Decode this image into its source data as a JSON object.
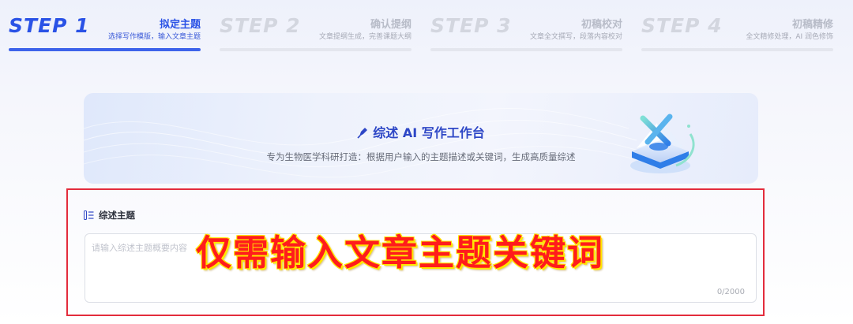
{
  "steps": [
    {
      "num": "STEP 1",
      "name": "拟定主题",
      "desc": "选择写作模版，输入文章主题",
      "active": true
    },
    {
      "num": "STEP 2",
      "name": "确认提纲",
      "desc": "文章提纲生成，完善课题大纲",
      "active": false
    },
    {
      "num": "STEP 3",
      "name": "初稿校对",
      "desc": "文章全文撰写，段落内容校对",
      "active": false
    },
    {
      "num": "STEP 4",
      "name": "初稿精修",
      "desc": "全文精修处理，AI 润色修饰",
      "active": false
    }
  ],
  "banner": {
    "title": "综述 AI 写作工作台",
    "subtitle": "专为生物医学科研打造：根据用户输入的主题描述或关键词，生成高质量综述"
  },
  "topic": {
    "label": "综述主题",
    "placeholder": "请输入综述主题概要内容",
    "counter": "0/2000"
  },
  "overlay": {
    "text": "仅需输入文章主题关键词"
  },
  "colors": {
    "accent": "#2a52e6",
    "highlight_border": "#e32c3c",
    "overlay_text": "#ff1c1c",
    "overlay_outline": "#ffe600"
  }
}
